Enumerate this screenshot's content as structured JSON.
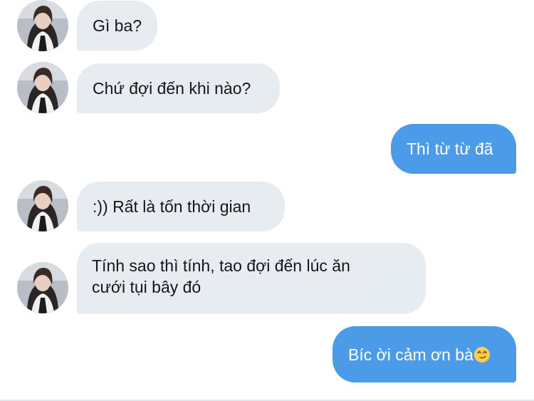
{
  "conversation": {
    "messages": [
      {
        "direction": "incoming",
        "text": "Gì ba?"
      },
      {
        "direction": "incoming",
        "text": "Chứ đợi đến khi nào?"
      },
      {
        "direction": "outgoing",
        "text": "Thì từ từ đã"
      },
      {
        "direction": "incoming",
        "text": ":)) Rất là tốn thời gian"
      },
      {
        "direction": "incoming",
        "lines": [
          "Tính sao thì tính, tao đợi đến lúc ăn",
          "cưới tụi bây đó"
        ]
      },
      {
        "direction": "outgoing",
        "text": "Bíc ời cảm ơn bà",
        "emoji": "smirking-face-icon"
      }
    ]
  },
  "colors": {
    "incoming_bubble": "#e6ecf0",
    "outgoing_bubble": "#4c9be8",
    "incoming_text": "#14171a",
    "outgoing_text": "#ffffff"
  }
}
